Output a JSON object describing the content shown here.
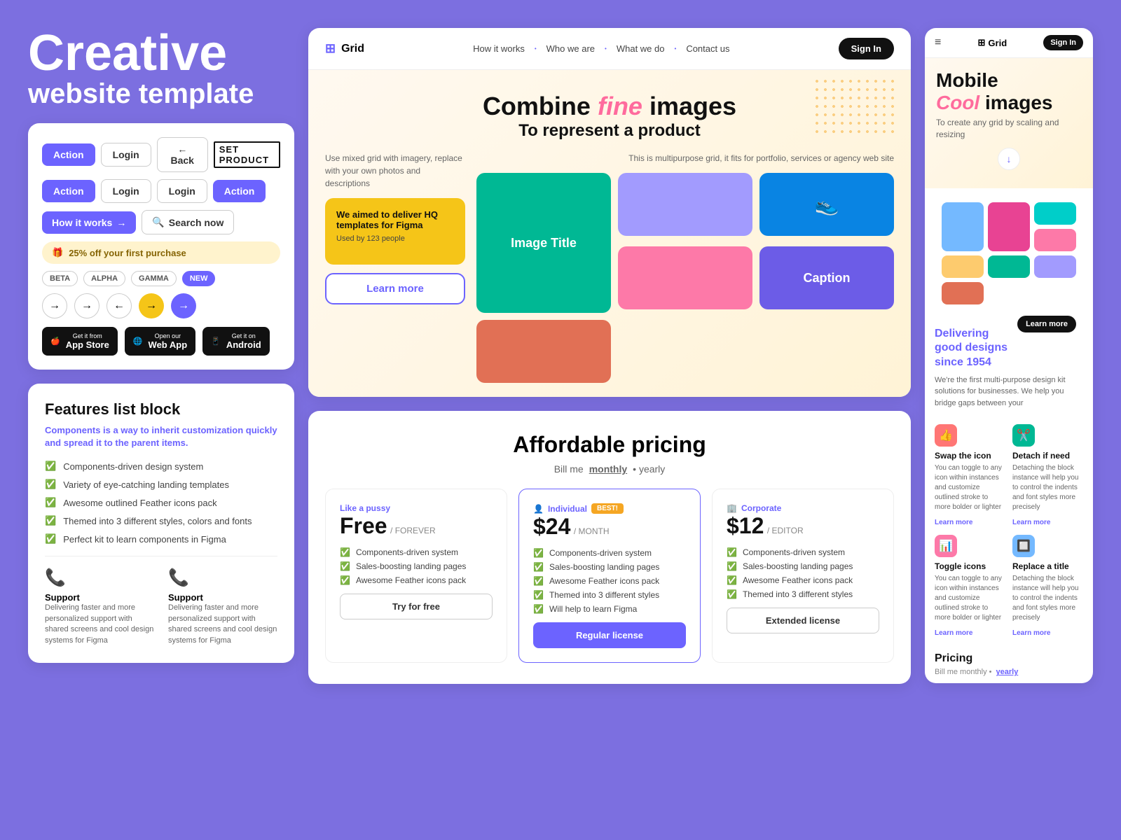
{
  "meta": {
    "bg": "#7c6fe0"
  },
  "left": {
    "hero": {
      "line1": "Creative",
      "line2": "website template"
    },
    "ui_card": {
      "btn_action1": "Action",
      "btn_login1": "Login",
      "btn_back": "← Back",
      "brand": "SET PRODUCT",
      "btn_action2": "Action",
      "btn_login2": "Login",
      "btn_login3": "Login",
      "btn_action3": "Action",
      "how_it_works": "How it works",
      "search_now": "Search now",
      "promo": "25% off your first purchase",
      "badges": [
        "BETA",
        "ALPHA",
        "GAMMA",
        "NEW"
      ],
      "store1": "App Store",
      "store1_sub": "Get it from",
      "store2": "Web App",
      "store2_sub": "Open our",
      "store3": "Android",
      "store3_sub": "Get it on"
    },
    "features": {
      "title": "Features list block",
      "subtitle": "Components is a way to inherit customization quickly and spread it to the parent items.",
      "items": [
        "Components-driven design system",
        "Variety of eye-catching landing templates",
        "Awesome outlined Feather icons pack",
        "Themed into 3 different styles, colors and fonts",
        "Perfect kit to learn components in Figma"
      ],
      "support1_title": "Support",
      "support1_desc": "Delivering faster and more personalized support with shared screens and cool design systems for Figma",
      "support2_title": "Support",
      "support2_desc": "Delivering faster and more personalized support with shared screens and cool design systems for Figma"
    }
  },
  "center": {
    "nav": {
      "logo": "Grid",
      "links": [
        "How it works",
        "Who we are",
        "What we do",
        "Contact us"
      ],
      "signin": "Sign In"
    },
    "hero": {
      "headline1": "Combine ",
      "headline_fine": "fine",
      "headline2": " images",
      "subheadline": "To represent a product",
      "left_text": "Use mixed grid with imagery, replace with your own photos and descriptions",
      "yellow_card_title": "We aimed to deliver HQ templates for Figma",
      "yellow_card_sub": "Used by 123 people",
      "learn_more": "Learn more",
      "right_text": "This is multipurpose grid, it fits for portfolio, services or agency web site",
      "image_title": "Image Title",
      "caption": "Caption"
    },
    "pricing": {
      "title": "Affordable pricing",
      "billing_label": "Bill me",
      "billing_monthly": "monthly",
      "billing_yearly": "• yearly",
      "plans": [
        {
          "tier": "Like a pussy",
          "name": "Free",
          "period": "/ FOREVER",
          "price": "",
          "features": [
            "Components-driven system",
            "Sales-boosting landing pages",
            "Awesome Feather icons pack"
          ],
          "cta": "Try for free",
          "featured": false
        },
        {
          "tier": "Individual",
          "badge": "BEST!",
          "name": "$24",
          "period": "/ MONTH",
          "features": [
            "Components-driven system",
            "Sales-boosting landing pages",
            "Awesome Feather icons pack",
            "Themed into 3 different styles",
            "Will help to learn Figma"
          ],
          "cta": "Regular license",
          "featured": true
        },
        {
          "tier": "Corporate",
          "name": "$12",
          "period": "/ EDITOR",
          "features": [
            "Components-driven system",
            "Sales-boosting landing pages",
            "Awesome Feather icons pack",
            "Themed into 3 different styles"
          ],
          "cta": "Extended license",
          "featured": false
        }
      ]
    }
  },
  "right": {
    "nav": {
      "logo": "Grid",
      "signin": "Sign In"
    },
    "hero": {
      "line1": "Mobile",
      "line2": "Cool",
      "line3": "images",
      "desc": "To create any grid by scaling and resizing"
    },
    "info": {
      "title_black": "Delivering good designs",
      "title_blue": "since 1954",
      "desc": "We're the first multi-purpose design kit solutions for businesses. We help you bridge gaps between   your",
      "learn_more": "Learn more"
    },
    "features": [
      {
        "icon": "👍",
        "icon_class": "icon-red",
        "title": "Swap the icon",
        "desc": "You can toggle to any icon within instances and customize outlined stroke to more bolder or lighter",
        "link": "Learn more"
      },
      {
        "icon": "✂️",
        "icon_class": "icon-green",
        "title": "Detach if need",
        "desc": "Detaching the block instance will help you to control the indents and font styles more precisely",
        "link": "Learn more"
      },
      {
        "icon": "📊",
        "icon_class": "icon-pink",
        "title": "Toggle icons",
        "desc": "You can toggle to any icon within instances and customize outlined stroke to more bolder or lighter",
        "link": "Learn more"
      },
      {
        "icon": "🔲",
        "icon_class": "icon-blue",
        "title": "Replace a title",
        "desc": "Detaching the block instance will help you to control the indents and font styles more precisely",
        "link": "Learn more"
      }
    ],
    "pricing": {
      "title": "Pricing",
      "billing_label": "Bill me monthly •",
      "billing_yearly": "yearly"
    }
  }
}
